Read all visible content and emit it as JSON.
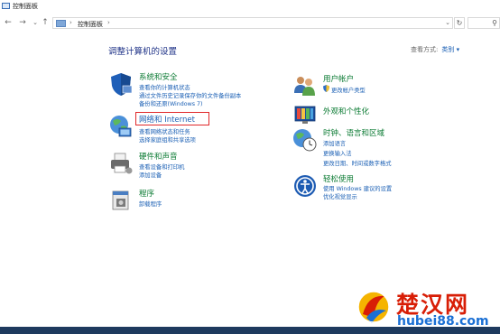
{
  "window": {
    "title": "控制面板"
  },
  "nav": {
    "back_glyph": "←",
    "forward_glyph": "→",
    "recent_glyph": "⌄",
    "up_glyph": "↑",
    "breadcrumb": "控制面板",
    "sep_glyph": "›",
    "dropdown_glyph": "⌄",
    "refresh_glyph": "↻",
    "search_glyph": "⚲"
  },
  "main": {
    "heading": "调整计算机的设置",
    "view_by_label": "查看方式:",
    "view_by_value": "类别 ▾"
  },
  "categories": [
    {
      "title": "系统和安全",
      "icon": "shield-icon",
      "links": [
        "查看你的计算机状态",
        "通过文件历史记录保存你的文件备份副本",
        "备份和还原(Windows 7)"
      ]
    },
    {
      "title": "网络和 Internet",
      "icon": "network-globe-icon",
      "links": [
        "查看网络状态和任务",
        "选择家庭组和共享选项"
      ]
    },
    {
      "title": "硬件和声音",
      "icon": "printer-icon",
      "links": [
        "查看设备和打印机",
        "添加设备"
      ]
    },
    {
      "title": "程序",
      "icon": "programs-icon",
      "links": [
        "卸载程序"
      ]
    },
    {
      "title": "用户帐户",
      "icon": "users-icon",
      "links": [
        "更改帐户类型"
      ]
    },
    {
      "title": "外观和个性化",
      "icon": "appearance-icon",
      "links": []
    },
    {
      "title": "时钟、语言和区域",
      "icon": "clock-globe-icon",
      "links": [
        "添加语言",
        "更换输入法",
        "更改日期、时间或数字格式"
      ]
    },
    {
      "title": "轻松使用",
      "icon": "ease-of-access-icon",
      "links": [
        "使用 Windows 建议的设置",
        "优化视觉显示"
      ]
    }
  ],
  "watermark": {
    "chinese": "楚汉网",
    "url": "hubei88.com"
  },
  "colors": {
    "category_title": "#0a7a32",
    "link": "#1a5fb4",
    "heading": "#1e3287",
    "highlight": "#e0282a"
  }
}
